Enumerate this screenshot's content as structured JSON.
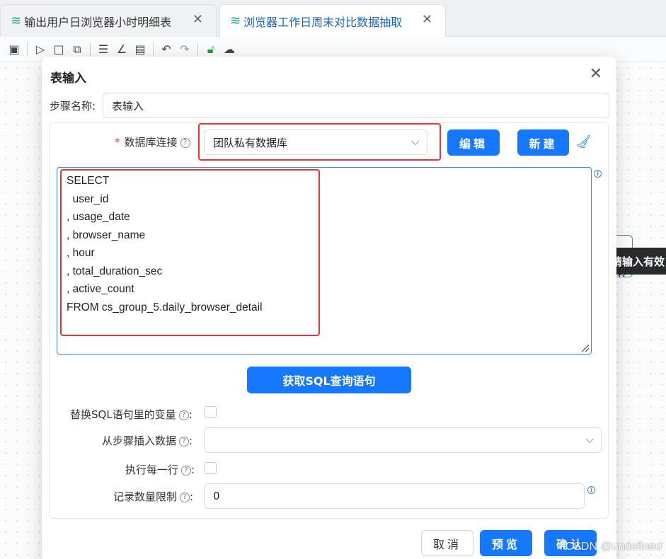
{
  "tabs": [
    {
      "label": "输出用户日浏览器小时明细表",
      "icon": "flow-icon"
    },
    {
      "label": "浏览器工作日周末对比数据抽取",
      "icon": "flow-icon"
    }
  ],
  "tab_close": "✕",
  "background": {
    "tooltip": "请输入有效",
    "node_label": "转"
  },
  "dialog": {
    "title": "表输入",
    "close": "✕",
    "step_name_label": "步骤名称:",
    "step_name_value": "表输入",
    "db_required_mark": "*",
    "db_label": "数据库连接",
    "db_value": "团队私有数据库",
    "edit_button": "编辑",
    "new_button": "新建",
    "sql_lines": [
      "SELECT",
      "  user_id",
      ", usage_date",
      ", browser_name",
      ", hour",
      ", total_duration_sec",
      ", active_count",
      "FROM cs_group_5.daily_browser_detail"
    ],
    "get_sql_button": "获取SQL查询语句",
    "replace_vars_label": "替换SQL语句里的变量",
    "insert_from_step_label": "从步骤插入数据",
    "insert_from_step_value": "",
    "execute_each_row_label": "执行每一行",
    "limit_label": "记录数量限制",
    "limit_value": "0",
    "colon": ":",
    "help_glyph": "?",
    "info_glyph": "i",
    "cancel_button": "取消",
    "preview_button": "预览",
    "confirm_button": "确认"
  },
  "watermark": "CSDN @undefined"
}
